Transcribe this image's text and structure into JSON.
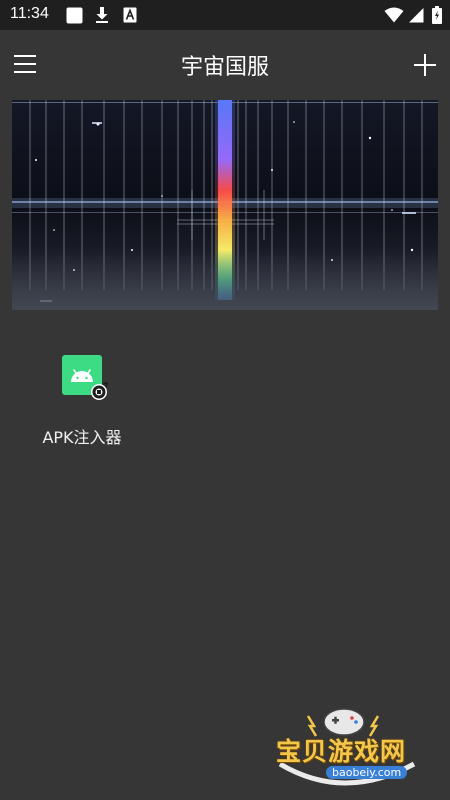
{
  "status_bar": {
    "time": "11:34",
    "left_icons": [
      "notification-square-icon",
      "download-icon",
      "font-a-icon"
    ],
    "right_icons": [
      "wifi-icon",
      "signal-icon",
      "battery-icon"
    ]
  },
  "toolbar": {
    "title": "宇宙国服",
    "menu_icon": "hamburger-menu-icon",
    "add_icon": "plus-icon"
  },
  "apps": [
    {
      "label": "APK注入器",
      "icon": "android-app-icon"
    }
  ],
  "watermark": {
    "title": "宝贝游戏网",
    "url": "baobeiy.com"
  },
  "colors": {
    "background": "#363636",
    "status_bar": "#1f1f1f",
    "android_green": "#3ddc84",
    "watermark_gold": "#f3c84a",
    "watermark_blue": "#3a7fd6"
  }
}
